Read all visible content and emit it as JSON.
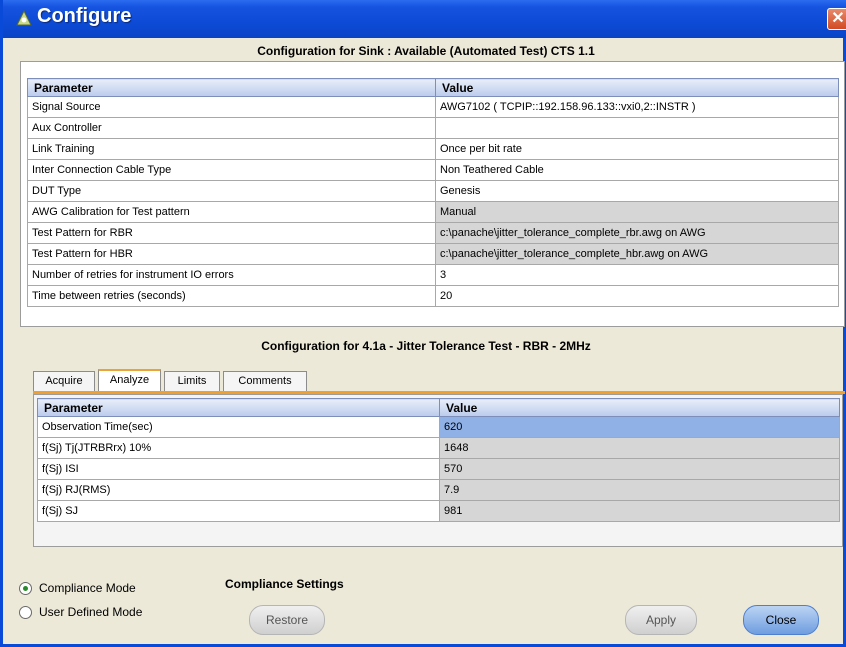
{
  "window": {
    "title": "Configure",
    "close_glyph": "✕"
  },
  "sink_section": {
    "title": "Configuration for Sink : Available (Automated Test) CTS 1.1",
    "columns": [
      "Parameter",
      "Value"
    ],
    "rows": [
      {
        "param": "Signal Source",
        "value": "AWG7102 ( TCPIP::192.158.96.133::vxi0,2::INSTR )"
      },
      {
        "param": "Aux Controller",
        "value": ""
      },
      {
        "param": "Link Training",
        "value": "Once per bit rate"
      },
      {
        "param": "Inter Connection Cable Type",
        "value": "Non Teathered Cable"
      },
      {
        "param": "DUT Type",
        "value": "Genesis"
      },
      {
        "param": "AWG Calibration for Test pattern",
        "value": "Manual"
      },
      {
        "param": "Test Pattern for RBR",
        "value": "c:\\panache\\jitter_tolerance_complete_rbr.awg on AWG"
      },
      {
        "param": "Test Pattern for HBR",
        "value": "c:\\panache\\jitter_tolerance_complete_hbr.awg on AWG"
      },
      {
        "param": "Number of retries for instrument IO errors",
        "value": "3"
      },
      {
        "param": "Time between retries (seconds)",
        "value": "20"
      }
    ]
  },
  "test_section": {
    "title": "Configuration for 4.1a - Jitter Tolerance Test - RBR - 2MHz",
    "tabs": [
      "Acquire",
      "Analyze",
      "Limits",
      "Comments"
    ],
    "active_tab": "Analyze",
    "columns": [
      "Parameter",
      "Value"
    ],
    "rows": [
      {
        "param": "Observation Time(sec)",
        "value": "620"
      },
      {
        "param": "f(Sj) Tj(JTRBRrx) 10%",
        "value": "1648"
      },
      {
        "param": "f(Sj) ISI",
        "value": "570"
      },
      {
        "param": "f(Sj) RJ(RMS)",
        "value": "7.9"
      },
      {
        "param": "f(Sj) SJ",
        "value": "981"
      }
    ]
  },
  "mode": {
    "options": [
      "Compliance Mode",
      "User Defined Mode"
    ],
    "selected": "Compliance Mode"
  },
  "compliance_settings": {
    "label": "Compliance Settings",
    "restore_label": "Restore"
  },
  "footer": {
    "apply_label": "Apply",
    "close_label": "Close"
  },
  "colors": {
    "titlebar": "#0d4bd6",
    "selected_row": "#8fb1e6",
    "tab_accent": "#f0a030",
    "header": "#bccbec"
  }
}
